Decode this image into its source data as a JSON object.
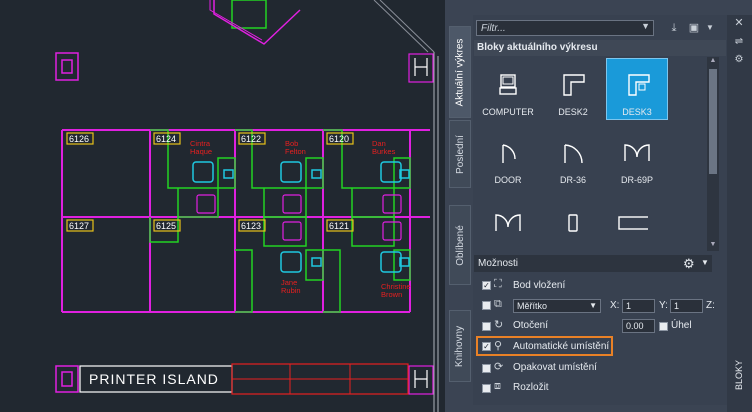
{
  "drawing": {
    "room_numbers": [
      "6126",
      "6124",
      "6122",
      "6120",
      "6127",
      "6125",
      "6123",
      "6121"
    ],
    "person_names": [
      {
        "line1": "Cintra",
        "line2": "Haque"
      },
      {
        "line1": "Bob",
        "line2": "Felton"
      },
      {
        "line1": "Dan",
        "line2": "Burkes"
      },
      {
        "line1": "Jane",
        "line2": "Rubin"
      },
      {
        "line1": "Christine",
        "line2": "Brown"
      }
    ],
    "printer_label": "PRINTER ISLAND"
  },
  "palette": {
    "tabs": [
      "Aktuální výkres",
      "Poslední",
      "Oblíbené",
      "Knihovny"
    ],
    "active_tab": "Aktuální výkres",
    "filter_placeholder": "Filtr...",
    "section_title": "Bloky aktuálního výkresu",
    "blocks": [
      {
        "label": "COMPUTER",
        "icon": "computer-block"
      },
      {
        "label": "DESK2",
        "icon": "desk2-block"
      },
      {
        "label": "DESK3",
        "icon": "desk3-block",
        "selected": true
      },
      {
        "label": "DOOR",
        "icon": "door-block"
      },
      {
        "label": "DR-36",
        "icon": "dr36-block"
      },
      {
        "label": "DR-69P",
        "icon": "dr69p-block"
      },
      {
        "label": "",
        "icon": "double-door-block"
      },
      {
        "label": "",
        "icon": "rectangle-block"
      },
      {
        "label": "",
        "icon": "wide-rectangle-block"
      }
    ],
    "options_title": "Možnosti",
    "options": {
      "insertion_point": {
        "label": "Bod vložení",
        "checked": true
      },
      "scale": {
        "mode": "Měřítko",
        "x_label": "X:",
        "x": "1",
        "y_label": "Y:",
        "y": "1",
        "z_label": "Z:",
        "checked": false
      },
      "rotation": {
        "label": "Otočení",
        "value": "0.00",
        "unit_label": "Úhel",
        "checked": false
      },
      "auto_placement": {
        "label": "Automatické umístění",
        "checked": true
      },
      "repeat_placement": {
        "label": "Opakovat umístění",
        "checked": false
      },
      "explode": {
        "label": "Rozložit",
        "checked": false
      }
    },
    "side_title": "BLOKY",
    "colors": {
      "accent": "#1a9ad9",
      "highlight": "#e98126",
      "magenta": "#e020e0",
      "green": "#22d322",
      "cyan": "#1fc8e0",
      "red": "#e62020",
      "yellow": "#e8c21a"
    }
  }
}
